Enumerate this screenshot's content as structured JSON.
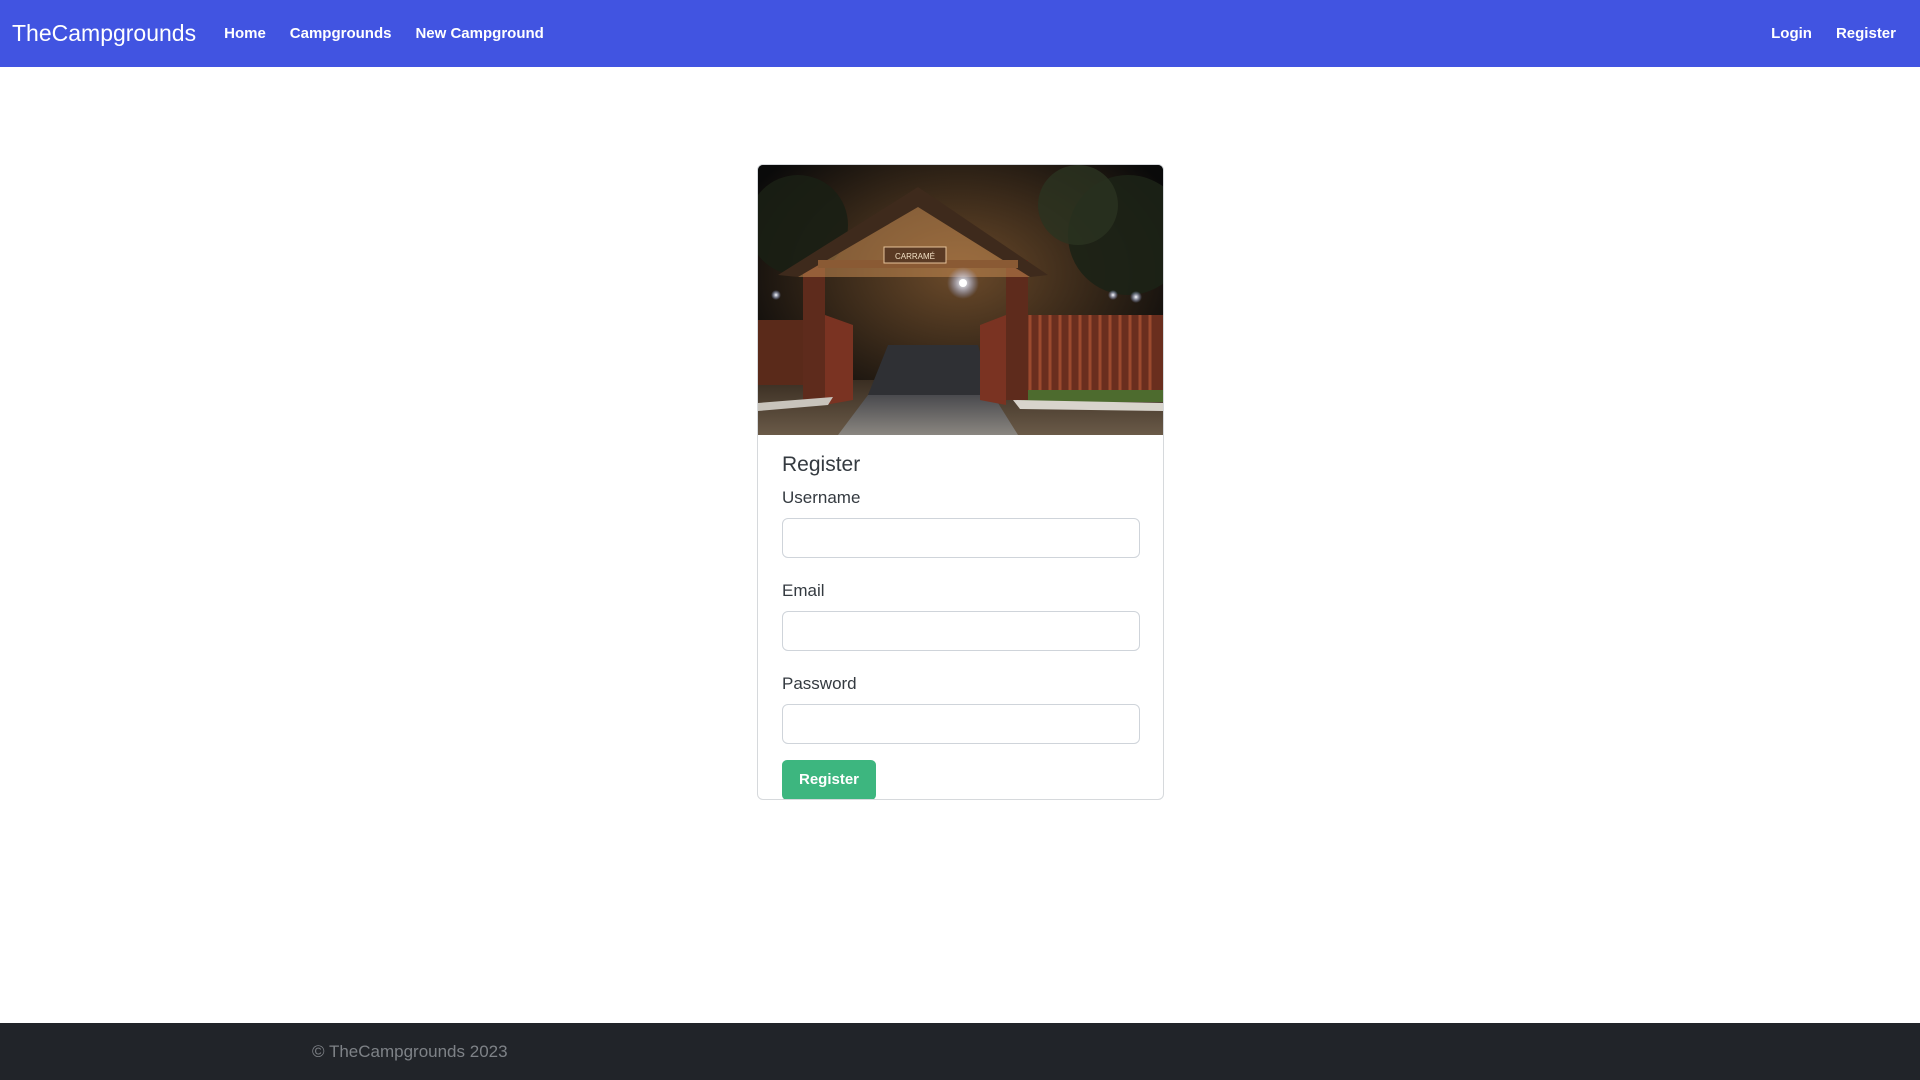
{
  "navbar": {
    "brand": "TheCampgrounds",
    "links": [
      "Home",
      "Campgrounds",
      "New Campground"
    ],
    "auth_links": [
      "Login",
      "Register"
    ],
    "background_color": "#4154e1"
  },
  "card": {
    "image_alt": "Campground entrance gate at night",
    "image_sign_text": "CARRAMÉ",
    "title": "Register",
    "fields": [
      {
        "label": "Username",
        "value": "",
        "placeholder": ""
      },
      {
        "label": "Email",
        "value": "",
        "placeholder": ""
      },
      {
        "label": "Password",
        "value": "",
        "placeholder": ""
      }
    ],
    "submit_label": "Register",
    "submit_color": "#3db67f"
  },
  "footer": {
    "text": "© TheCampgrounds 2023",
    "background_color": "#212429"
  }
}
